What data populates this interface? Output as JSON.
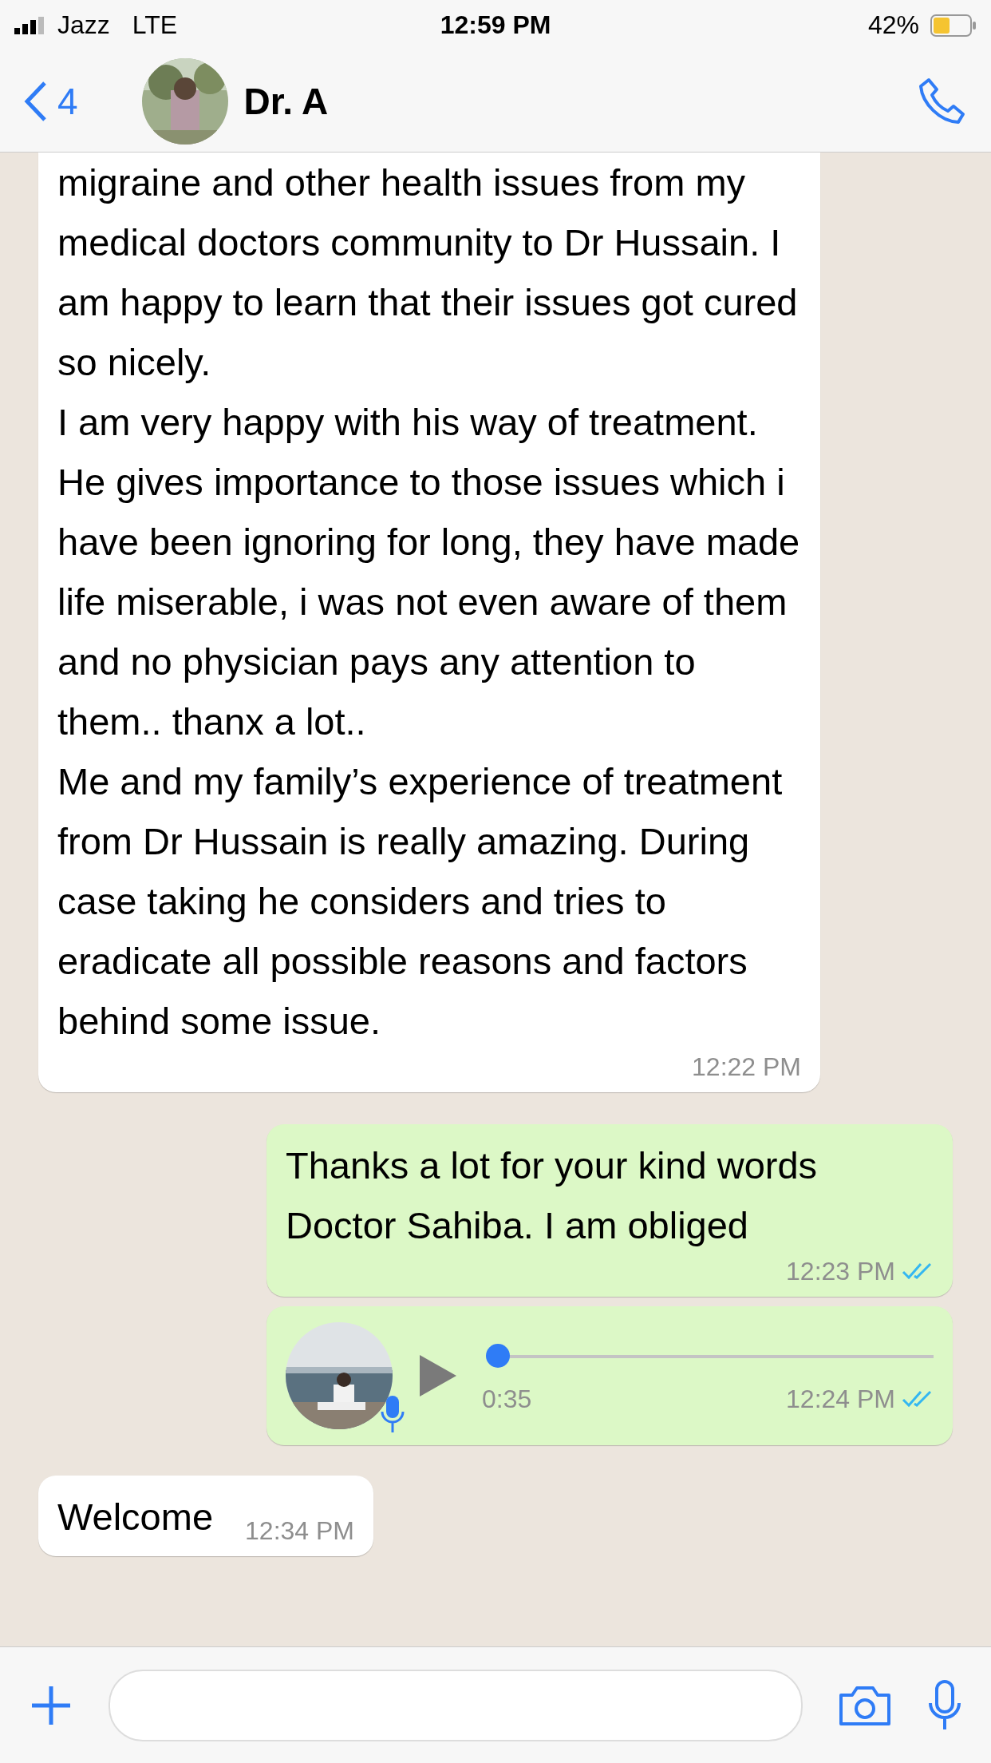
{
  "status_bar": {
    "carrier": "Jazz",
    "network": "LTE",
    "time": "12:59 PM",
    "battery": "42%"
  },
  "header": {
    "back_count": "4",
    "contact_name": "Dr. A"
  },
  "messages": [
    {
      "kind": "text",
      "outgoing": false,
      "paragraphs": [
        "migraine and other health issues from my medical doctors community to Dr Hussain. I am happy to learn that their issues got cured so nicely.",
        "I am very happy with his way of treatment. He gives importance to those issues which i have been ignoring for long, they have made life miserable, i was not even aware of them and no physician pays any attention to them.. thanx a lot..",
        "Me and my family’s experience of treatment from Dr Hussain is really amazing. During case taking he considers and tries to eradicate all possible reasons and factors behind some issue."
      ],
      "time": "12:22 PM"
    },
    {
      "kind": "text",
      "outgoing": true,
      "paragraphs": [
        "Thanks a lot for your kind words Doctor Sahiba. I am obliged"
      ],
      "time": "12:23 PM",
      "read": true
    },
    {
      "kind": "voice",
      "outgoing": true,
      "duration": "0:35",
      "level": 0,
      "time": "12:24 PM",
      "read": true
    },
    {
      "kind": "text",
      "outgoing": false,
      "paragraphs": [
        "Welcome"
      ],
      "time": "12:34 PM"
    }
  ]
}
